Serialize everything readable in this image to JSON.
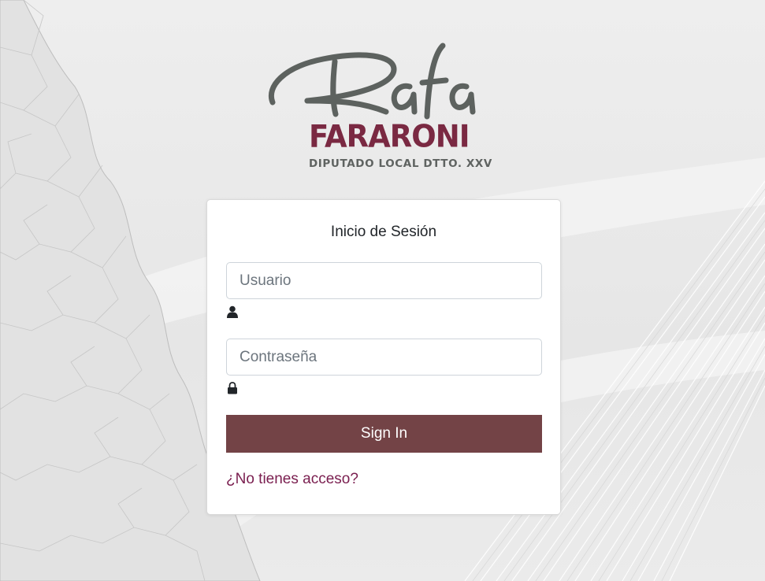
{
  "branding": {
    "script_name": "Rafa",
    "name": "FARARONI",
    "subtitle": "DIPUTADO LOCAL DTTO. XXV",
    "script_color": "#5d625f",
    "name_color": "#7a2942"
  },
  "login": {
    "title": "Inicio de Sesión",
    "username_placeholder": "Usuario",
    "username_value": "",
    "username_icon": "user-icon",
    "password_placeholder": "Contraseña",
    "password_value": "",
    "password_icon": "lock-icon",
    "submit_label": "Sign In",
    "submit_color": "#734346",
    "no_access_link": "¿No tienes acceso?",
    "link_color": "#7a1e4f"
  }
}
